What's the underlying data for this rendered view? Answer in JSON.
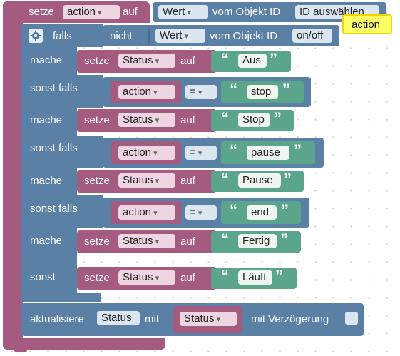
{
  "top_block": {
    "setze": "setze",
    "var_name": "action",
    "auf": "auf",
    "wert": "Wert",
    "vom_objekt_id": "vom Objekt ID",
    "id_placeholder": "ID auswählen"
  },
  "tooltip": "action",
  "if_block": {
    "falls": "falls",
    "nicht": "nicht",
    "wert": "Wert",
    "vom_objekt_id": "vom Objekt ID",
    "object_id": "on/off"
  },
  "labels": {
    "mache": "mache",
    "sonst_falls": "sonst falls",
    "sonst": "sonst"
  },
  "set_blocks": [
    {
      "setze": "setze",
      "var": "Status",
      "auf": "auf",
      "text": "Aus"
    },
    {
      "setze": "setze",
      "var": "Status",
      "auf": "auf",
      "text": "Stop"
    },
    {
      "setze": "setze",
      "var": "Status",
      "auf": "auf",
      "text": "Pause"
    },
    {
      "setze": "setze",
      "var": "Status",
      "auf": "auf",
      "text": "Fertig"
    },
    {
      "setze": "setze",
      "var": "Status",
      "auf": "auf",
      "text": "Läuft"
    }
  ],
  "conditions": [
    {
      "var": "action",
      "op": "=",
      "text": "stop"
    },
    {
      "var": "action",
      "op": "=",
      "text": "pause"
    },
    {
      "var": "action",
      "op": "=",
      "text": "end"
    }
  ],
  "update_block": {
    "aktualisiere": "aktualisiere",
    "status_field": "Status",
    "mit": "mit",
    "status_var": "Status",
    "mit_verzoegerung": "mit Verzögerung"
  },
  "quote_open": "“",
  "quote_close": "”",
  "colors": {
    "variables": "#a55b80",
    "logic": "#5b80a5",
    "text": "#5ba58c",
    "tooltip": "#ffff66"
  },
  "icons": {
    "gear": "gear-icon"
  }
}
